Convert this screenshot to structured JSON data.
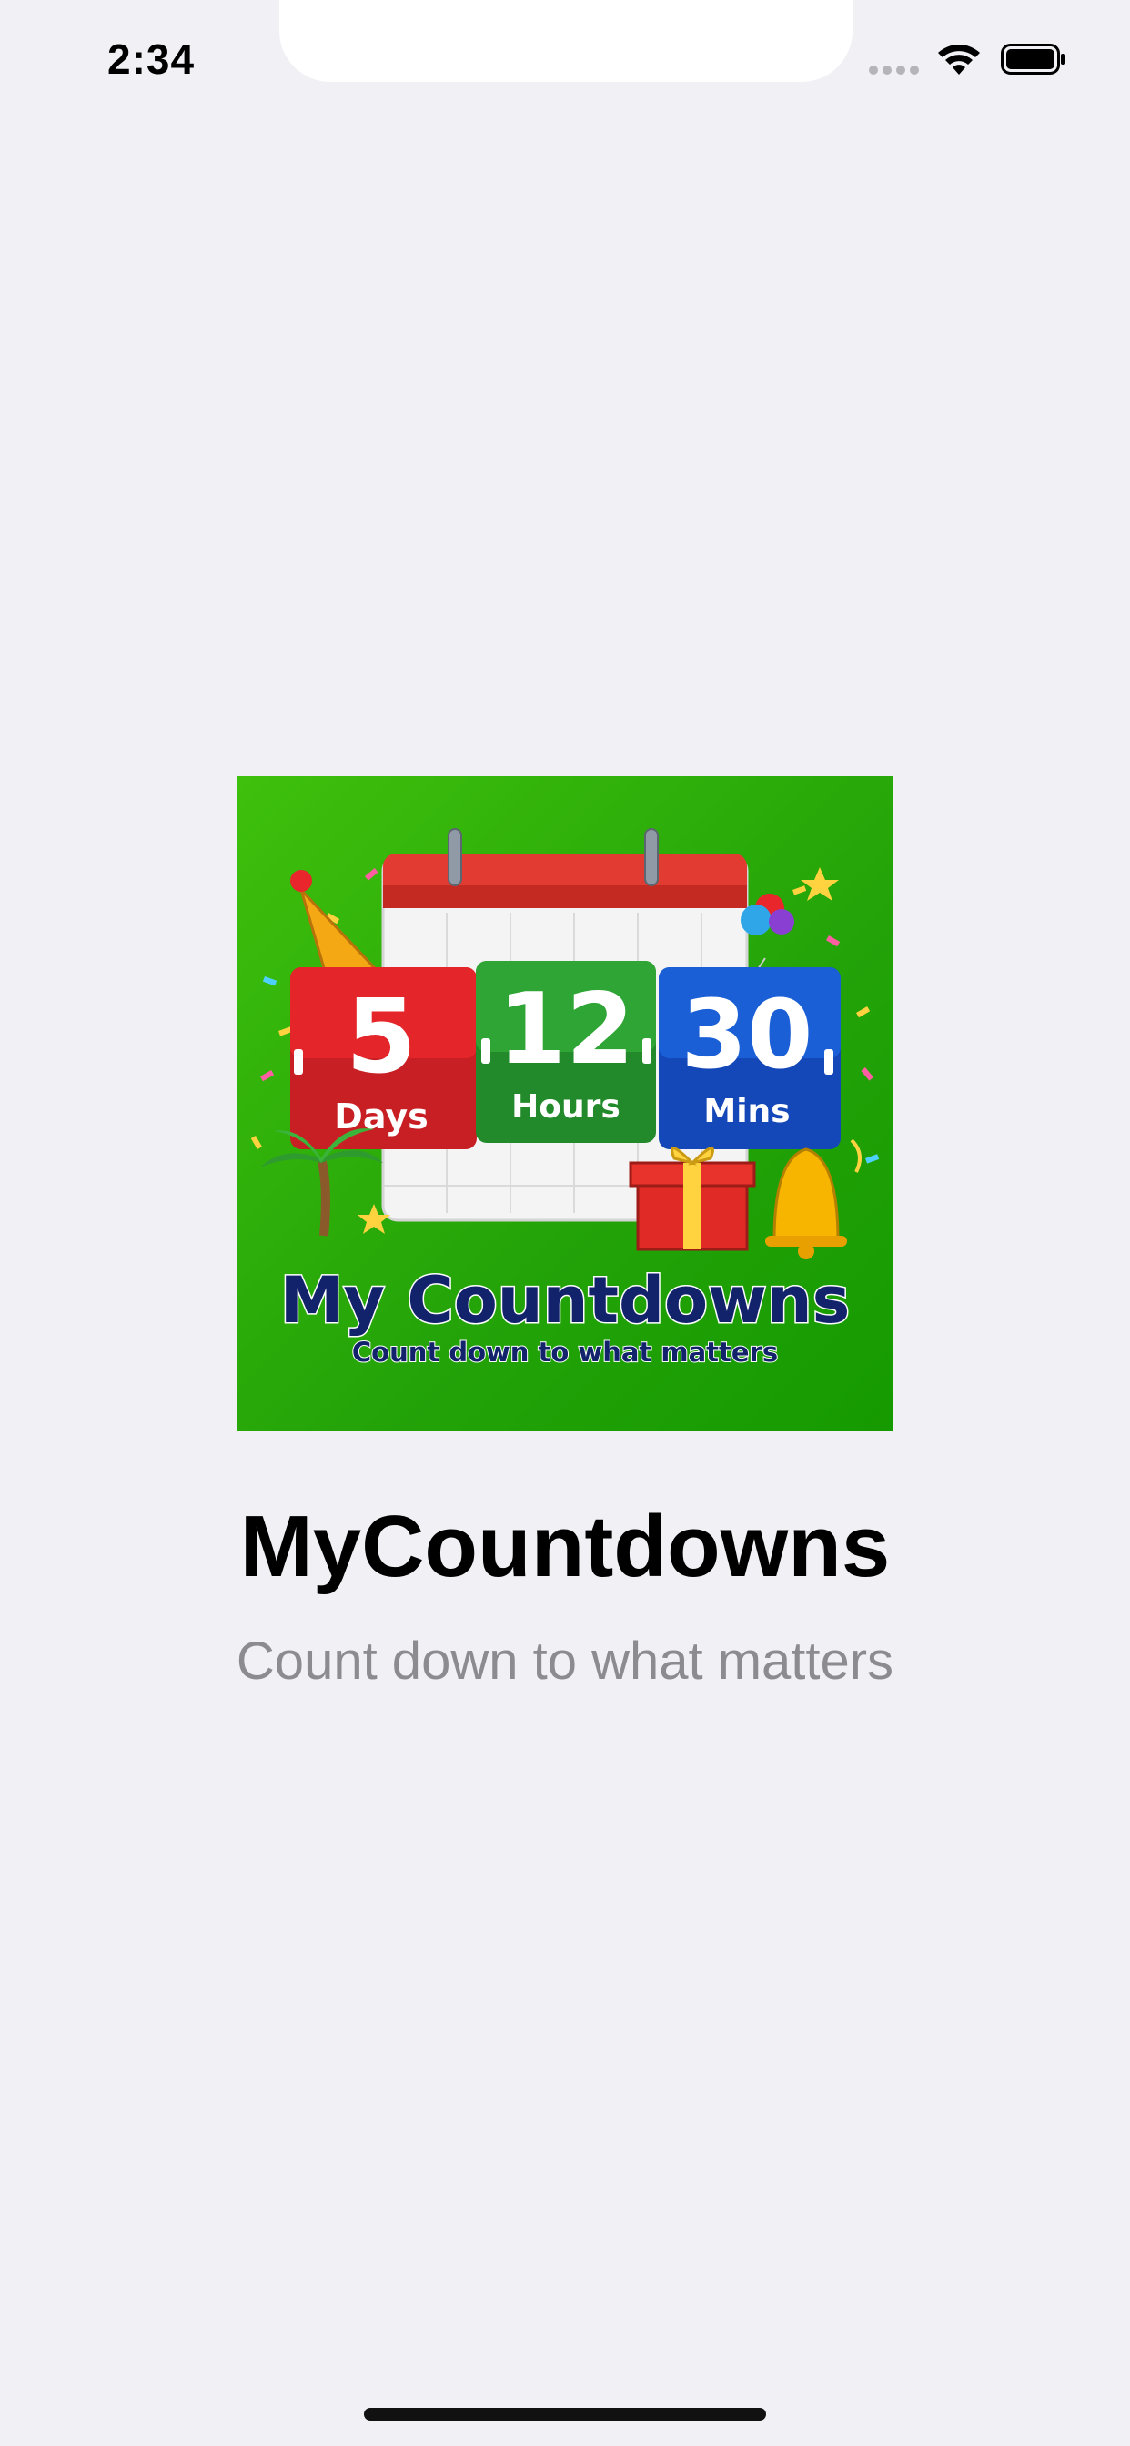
{
  "status_bar": {
    "time": "2:34"
  },
  "splash": {
    "app_name": "MyCountdowns",
    "tagline": "Count down to what matters"
  },
  "icon_art": {
    "flip_cards": [
      {
        "number": "5",
        "unit": "Days",
        "color": "#e4262b"
      },
      {
        "number": "12",
        "unit": "Hours",
        "color": "#2ea534"
      },
      {
        "number": "30",
        "unit": "Mins",
        "color": "#1a5fd6"
      }
    ],
    "title": "My Countdowns",
    "subtitle": "Count down to what matters"
  },
  "colors": {
    "background": "#f1f0f5",
    "icon_green": "#23a308",
    "title_navy": "#12236b",
    "subtitle_gray": "#8b8b90"
  },
  "icons": [
    "cellular-signal-icon",
    "wifi-icon",
    "battery-icon"
  ]
}
